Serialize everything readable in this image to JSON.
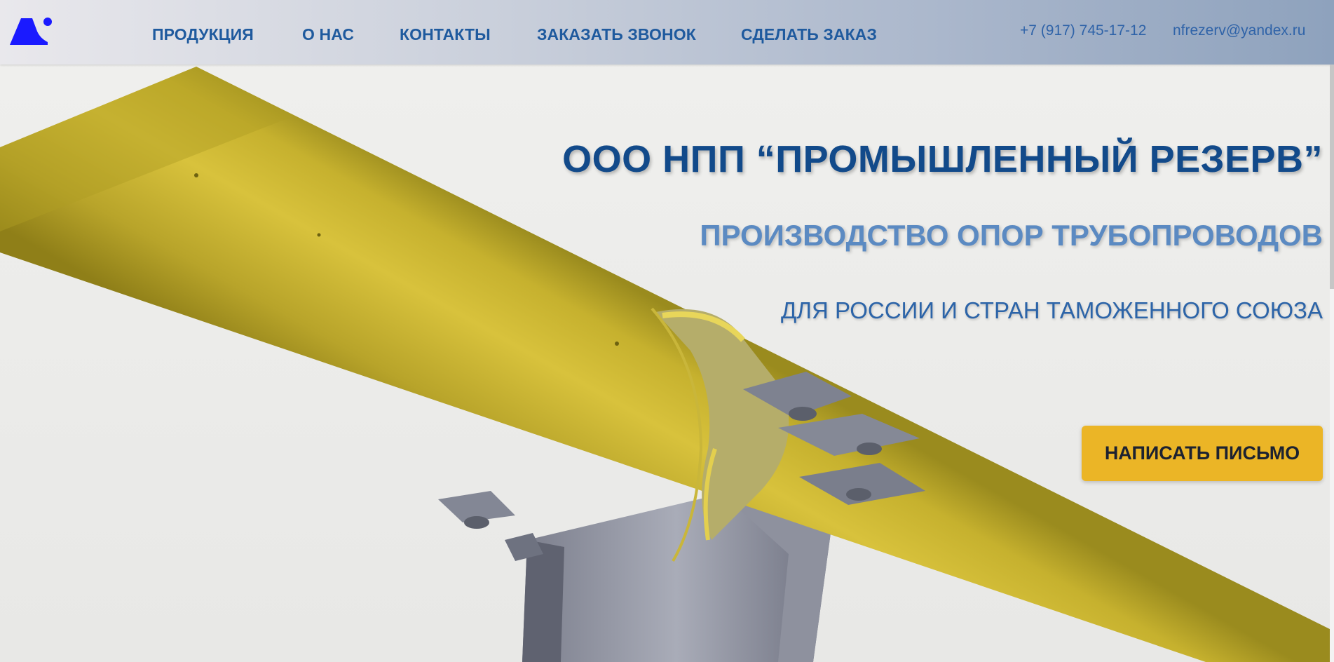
{
  "header": {
    "logo_name": "company-logo",
    "nav": [
      {
        "label": "ПРОДУКЦИЯ"
      },
      {
        "label": "О НАС"
      },
      {
        "label": "КОНТАКТЫ"
      },
      {
        "label": "ЗАКАЗАТЬ ЗВОНОК"
      },
      {
        "label": "СДЕЛАТЬ ЗАКАЗ"
      }
    ],
    "phone": "+7 (917) 745-17-12",
    "email": "nfrezerv@yandex.ru"
  },
  "hero": {
    "title": "ООО НПП “ПРОМЫШЛЕННЫЙ РЕЗЕРВ”",
    "subtitle": "ПРОИЗВОДСТВО ОПОР ТРУБОПРОВОДОВ",
    "tagline": "ДЛЯ РОССИИ И СТРАН ТАМОЖЕННОГО СОЮЗА",
    "cta_label": "НАПИСАТЬ ПИСЬМО"
  },
  "colors": {
    "nav_text": "#1f5a9e",
    "title": "#124a8a",
    "subtitle": "#5b8ac2",
    "cta_bg": "#ebb526",
    "pipe": "#c8b32e",
    "logo": "#1a1aff"
  }
}
